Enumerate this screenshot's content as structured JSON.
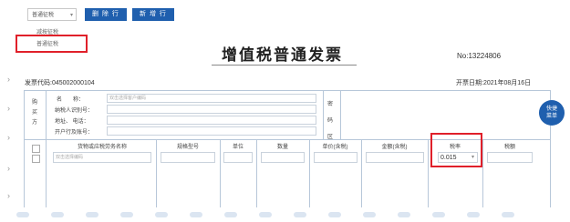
{
  "toolbar": {
    "select_value": "普通征税",
    "delete_row_label": "删 除 行",
    "add_row_label": "新 增 行"
  },
  "dropdown": {
    "options": [
      "减按征税",
      "普通征税"
    ]
  },
  "invoice": {
    "title": "增值税普通发票",
    "number": "No:13224806",
    "code_label": "发票代码:045002000104",
    "date_label": "开票日期:2021年08月16日"
  },
  "buyer": {
    "side_label": [
      "购",
      "买",
      "方"
    ],
    "name_label": "名　　称：",
    "name_placeholder": "双击选择客户编码",
    "taxid_label": "纳税人识别号：",
    "address_label": "地址、 电话：",
    "bank_label": "开户行及账号：",
    "secret_labels": [
      "密",
      "码",
      "区"
    ]
  },
  "items": {
    "headers": [
      "货物或应税劳务名称",
      "规格型号",
      "单位",
      "数量",
      "单价(含税)",
      "金额(含税)",
      "税率",
      "税额"
    ],
    "first_row_placeholder": "双击选择编码",
    "tax_rate_value": "0.015"
  },
  "quick_button": [
    "快捷",
    "菜单"
  ],
  "icons": {
    "caret": "chevron-down-icon",
    "side_arrow": "chevron-right-icon"
  },
  "colors": {
    "primary": "#1f5fae",
    "highlight": "#e0202a"
  }
}
